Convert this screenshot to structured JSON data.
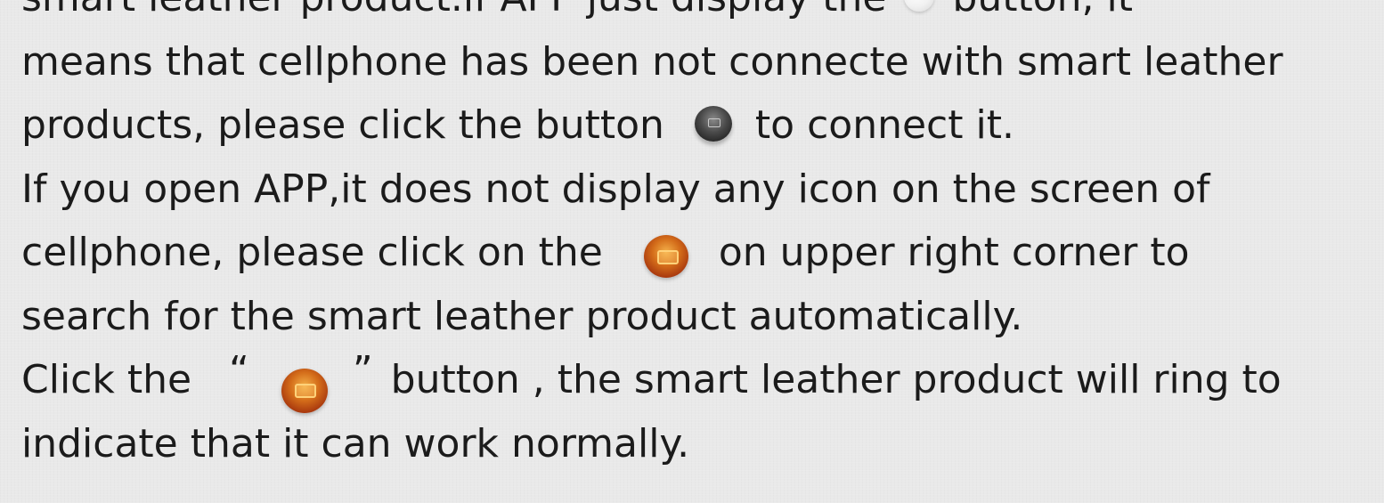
{
  "paragraph": {
    "line0": {
      "before": "smart leather product.if APP just display the",
      "after": "button, it"
    },
    "line1": "means that cellphone has been not connecte with smart leather",
    "line2": {
      "before": "products, please click the button",
      "after": "to connect it."
    },
    "line3": "If you open APP,it does not display any icon on the screen of",
    "line4": {
      "before": "cellphone, please click on the",
      "after": "on upper right corner to"
    },
    "line5": "search for the smart leather product automatically.",
    "line6": {
      "before": "Click the",
      "quote_open": "“",
      "quote_close": "”",
      "after": "button , the smart leather product will ring to"
    },
    "line7": "indicate that it can work normally."
  },
  "icons": {
    "disconnected": "white-circle-button-icon",
    "connect": "gray-connect-button-icon",
    "search": "orange-search-button-icon",
    "ring": "orange-ring-button-icon"
  },
  "colors": {
    "background": "#e9e9e9",
    "text": "#1b1b1b",
    "connect_button": "#3a3a3a",
    "orange_button": "#d46d1a"
  }
}
